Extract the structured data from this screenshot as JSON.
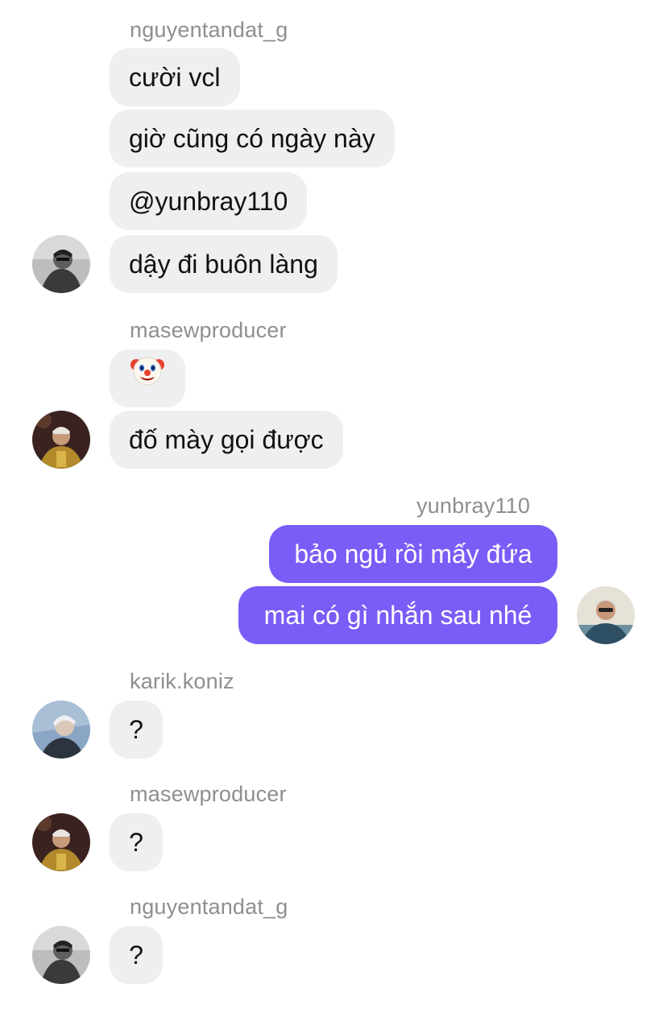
{
  "groups": [
    {
      "sender": "nguyentandat_g",
      "messages": [
        "cười vcl",
        "giờ cũng có ngày này",
        "@yunbray110",
        "dậy đi buôn làng"
      ]
    },
    {
      "sender": "masewproducer",
      "messages": [
        "clown-face-emoji",
        "đố mày gọi được"
      ]
    },
    {
      "sender": "yunbray110",
      "messages": [
        "bảo ngủ rồi mấy đứa",
        "mai có gì nhắn sau nhé"
      ]
    },
    {
      "sender": "karik.koniz",
      "messages": [
        "?"
      ]
    },
    {
      "sender": "masewproducer",
      "messages": [
        "?"
      ]
    },
    {
      "sender": "nguyentandat_g",
      "messages": [
        "?"
      ]
    }
  ],
  "colors": {
    "incoming_bubble": "#efeff1",
    "outgoing_bubble": "#7a5cf6",
    "sender_name": "#8e8e93"
  }
}
